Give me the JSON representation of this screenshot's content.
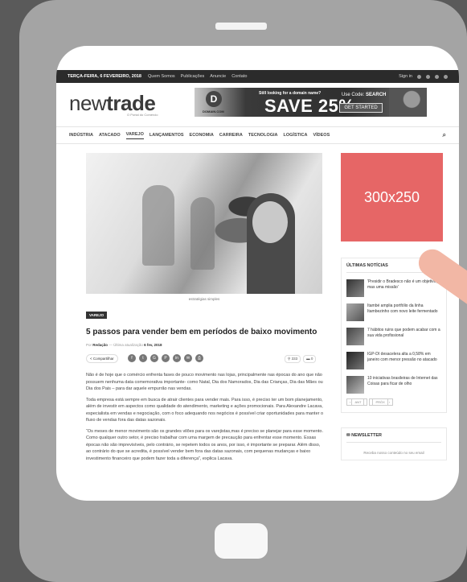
{
  "topbar": {
    "date": "TERÇA-FEIRA, 6 FEVEREIRO, 2018",
    "links": [
      "Quem Somos",
      "Publicações",
      "Anuncie",
      "Contato"
    ],
    "signin": "Sign in"
  },
  "header": {
    "logo_light": "new",
    "logo_bold": "trade",
    "tagline": "O Portal do Comércio",
    "banner": {
      "brand_mark": "D",
      "brand_name": "DOMAIN.COM",
      "question": "Still looking for a domain name?",
      "headline": "SAVE 25%",
      "code_prefix": "Use Code:",
      "code": "SEARCH",
      "cta": "GET STARTED"
    }
  },
  "nav": {
    "items": [
      "INDÚSTRIA",
      "ATACADO",
      "VAREJO",
      "LANÇAMENTOS",
      "ECONOMIA",
      "CARREIRA",
      "TECNOLOGIA",
      "LOGÍSTICA",
      "VÍDEOS"
    ],
    "active": "VAREJO"
  },
  "article": {
    "caption": "estratégias simples",
    "tag": "VAREJO",
    "title": "5 passos para vender bem em períodos de baixo movimento",
    "by_label": "Por",
    "author": "Redação",
    "updated_label": "Última atualização",
    "date": "6 fev, 2018",
    "share_label": "Compartilhar",
    "share_icons": [
      "f",
      "t",
      "G",
      "P",
      "in",
      "✉",
      "⎙"
    ],
    "views": "333",
    "comments": "0",
    "paragraphs": [
      "Não é de hoje que o comércio enfrenta fases de pouco movimento nas lojas, principalmente nas épocas do ano que não possuem nenhuma data comemorativa importante- como Natal, Dia dos Namorados, Dia das Crianças, Dia das Mães ou Dia dos Pais – para dar aquele empurrão nas vendas.",
      "Toda empresa está sempre em busca de atrair clientes para vender mais. Para isso, é preciso ter um bom planejamento, além de investir em aspectos como qualidade do atendimento, marketing e ações promocionais. Para Alexandre Lacava, especialista em vendas e negociação, com o foco adequando nos negócios é possível criar oportunidades para manter o fluxo de vendas fora das datas sazonais.",
      "“Os meses de menor movimento são os grandes vilões para os varejistas,mas é preciso se planejar para esse momento. Como qualquer outro setor, é preciso trabalhar com uma margem de precaução para enfrentar esse momento. Essas épocas não são imprevisíveis, pelo contrário, se repetem todos os anos, por isso, é importante se preparar. Além disso, ao contrário do que se acredita, é possível vender bem fora das datas sazonais, com pequenas mudanças e baixo investimento financeiro que podem fazer toda a diferença”, explica Lacava."
    ]
  },
  "sidebar": {
    "ad_label": "300x250",
    "news_title": "ÚLTIMAS NOTÍCIAS",
    "news": [
      "'Presidir o Bradesco não é um objetivo, mas uma missão'",
      "Itambé amplia portfólio da linha Itambezinho com novo leite fermentado",
      "7 hábitos ruins que podem acabar com a sua vida profissional",
      "IGP-DI desacelera alta a 0,58% em janeiro com menor pressão no atacado",
      "10 iniciativas brasileiras de Internet das Coisas para ficar de olho"
    ],
    "prev": "ANT",
    "next": "PRÓX",
    "newsletter_title": "NEWSLETTER",
    "newsletter_text": "Receba nosso conteúdo no seu email"
  }
}
